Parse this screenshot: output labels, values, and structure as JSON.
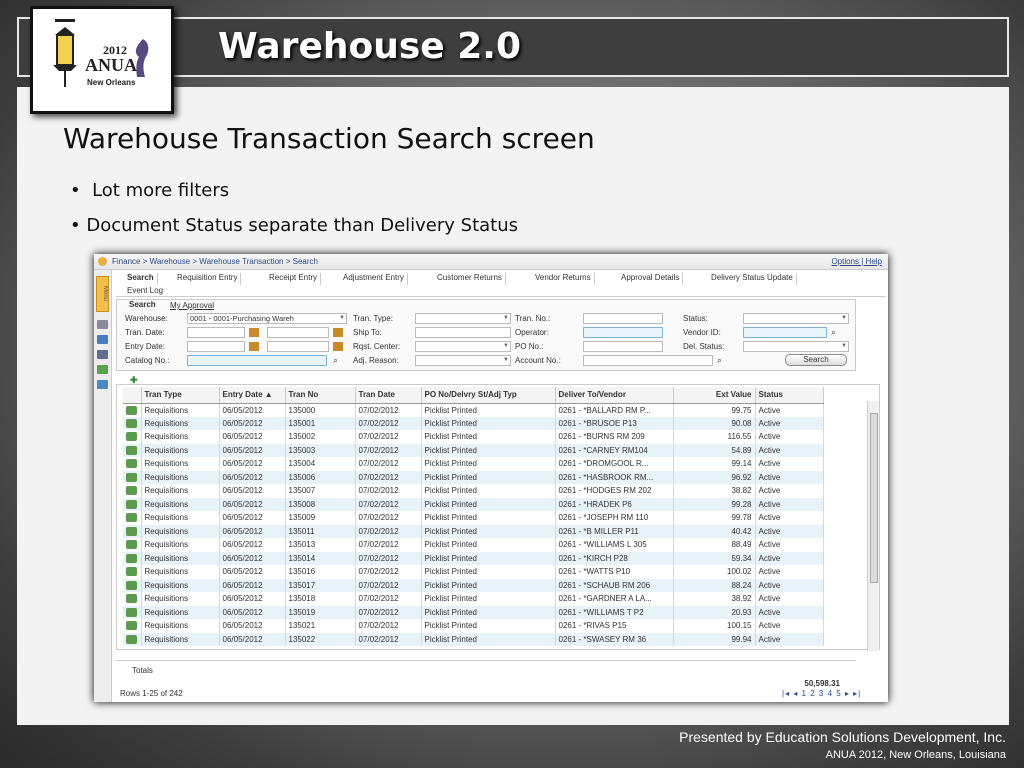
{
  "slide": {
    "title": "Warehouse 2.0",
    "heading": "Warehouse Transaction Search screen",
    "bullets": [
      "Lot more filters",
      "Document Status separate than Delivery Status"
    ],
    "footer_line1": "Presented by Education Solutions Development, Inc.",
    "footer_line2": "ANUA 2012, New Orleans, Louisiana"
  },
  "logo": {
    "year": "2012",
    "name": "ANUA",
    "city": "New Orleans"
  },
  "app": {
    "breadcrumb": "Finance > Warehouse > Warehouse Transaction > Search",
    "top_links": "Options | Help",
    "menu_label": "Menu",
    "tabs": [
      "Search",
      "Requisition Entry",
      "Receipt Entry",
      "Adjustment Entry",
      "Customer Returns",
      "Vendor Returns",
      "Approval Details",
      "Delivery Status Update",
      "Event Log"
    ],
    "subtabs": [
      "Search",
      "My Approval"
    ],
    "filters": {
      "warehouse_label": "Warehouse:",
      "warehouse_value": "0001 - 0001-Purchasing Wareh",
      "tran_type_label": "Tran. Type:",
      "tran_no_label": "Tran. No.:",
      "status_label": "Status:",
      "tran_date_label": "Tran. Date:",
      "ship_to_label": "Ship To:",
      "operator_label": "Operator:",
      "vendor_id_label": "Vendor ID:",
      "entry_date_label": "Entry Date:",
      "rqst_center_label": "Rqst. Center:",
      "po_no_label": "PO No.:",
      "del_status_label": "Del. Status:",
      "catalog_label": "Catalog No.:",
      "adj_reason_label": "Adj. Reason:",
      "account_no_label": "Account No.:",
      "search_button": "Search"
    },
    "grid": {
      "columns": [
        "Tran Type",
        "Entry Date ▲",
        "Tran No",
        "Tran Date",
        "PO No/Delvry St/Adj Typ",
        "Deliver To/Vendor",
        "Ext Value",
        "Status"
      ],
      "rows": [
        [
          "Requisitions",
          "06/05/2012",
          "135000",
          "07/02/2012",
          "Picklist Printed",
          "0261 - *BALLARD RM P...",
          "99.75",
          "Active"
        ],
        [
          "Requisitions",
          "06/05/2012",
          "135001",
          "07/02/2012",
          "Picklist Printed",
          "0261 - *BRUSOE P13",
          "90.08",
          "Active"
        ],
        [
          "Requisitions",
          "06/05/2012",
          "135002",
          "07/02/2012",
          "Picklist Printed",
          "0261 - *BURNS RM 209",
          "116.55",
          "Active"
        ],
        [
          "Requisitions",
          "06/05/2012",
          "135003",
          "07/02/2012",
          "Picklist Printed",
          "0261 - *CARNEY RM104",
          "54.89",
          "Active"
        ],
        [
          "Requisitions",
          "06/05/2012",
          "135004",
          "07/02/2012",
          "Picklist Printed",
          "0261 - *DROMGOOL R...",
          "99.14",
          "Active"
        ],
        [
          "Requisitions",
          "06/05/2012",
          "135006",
          "07/02/2012",
          "Picklist Printed",
          "0261 - *HASBROOK RM...",
          "96.92",
          "Active"
        ],
        [
          "Requisitions",
          "06/05/2012",
          "135007",
          "07/02/2012",
          "Picklist Printed",
          "0261 - *HODGES RM 202",
          "38.82",
          "Active"
        ],
        [
          "Requisitions",
          "06/05/2012",
          "135008",
          "07/02/2012",
          "Picklist Printed",
          "0261 - *HRADEK P6",
          "99.28",
          "Active"
        ],
        [
          "Requisitions",
          "06/05/2012",
          "135009",
          "07/02/2012",
          "Picklist Printed",
          "0261 - *JOSEPH RM 110",
          "99.78",
          "Active"
        ],
        [
          "Requisitions",
          "06/05/2012",
          "135011",
          "07/02/2012",
          "Picklist Printed",
          "0261 - *B MILLER P11",
          "40.42",
          "Active"
        ],
        [
          "Requisitions",
          "06/05/2012",
          "135013",
          "07/02/2012",
          "Picklist Printed",
          "0261 - *WILLIAMS L 305",
          "88.49",
          "Active"
        ],
        [
          "Requisitions",
          "06/05/2012",
          "135014",
          "07/02/2012",
          "Picklist Printed",
          "0261 - *KIRCH P28",
          "59.34",
          "Active"
        ],
        [
          "Requisitions",
          "06/05/2012",
          "135016",
          "07/02/2012",
          "Picklist Printed",
          "0261 - *WATTS P10",
          "100.02",
          "Active"
        ],
        [
          "Requisitions",
          "06/05/2012",
          "135017",
          "07/02/2012",
          "Picklist Printed",
          "0261 - *SCHAUB RM 206",
          "88.24",
          "Active"
        ],
        [
          "Requisitions",
          "06/05/2012",
          "135018",
          "07/02/2012",
          "Picklist Printed",
          "0261 - *GARDNER A LA...",
          "38.92",
          "Active"
        ],
        [
          "Requisitions",
          "06/05/2012",
          "135019",
          "07/02/2012",
          "Picklist Printed",
          "0261 - *WILLIAMS T P2",
          "20.93",
          "Active"
        ],
        [
          "Requisitions",
          "06/05/2012",
          "135021",
          "07/02/2012",
          "Picklist Printed",
          "0261 - *RIVAS P15",
          "100.15",
          "Active"
        ],
        [
          "Requisitions",
          "06/05/2012",
          "135022",
          "07/02/2012",
          "Picklist Printed",
          "0261 - *SWASEY RM 36",
          "99.94",
          "Active"
        ]
      ]
    },
    "totals_label": "Totals",
    "totals_value": "50,598.31",
    "rows_info": "Rows 1-25 of 242",
    "pager": "|◂ ◂ 1 2 3 4 5 ▸ ▸|"
  }
}
